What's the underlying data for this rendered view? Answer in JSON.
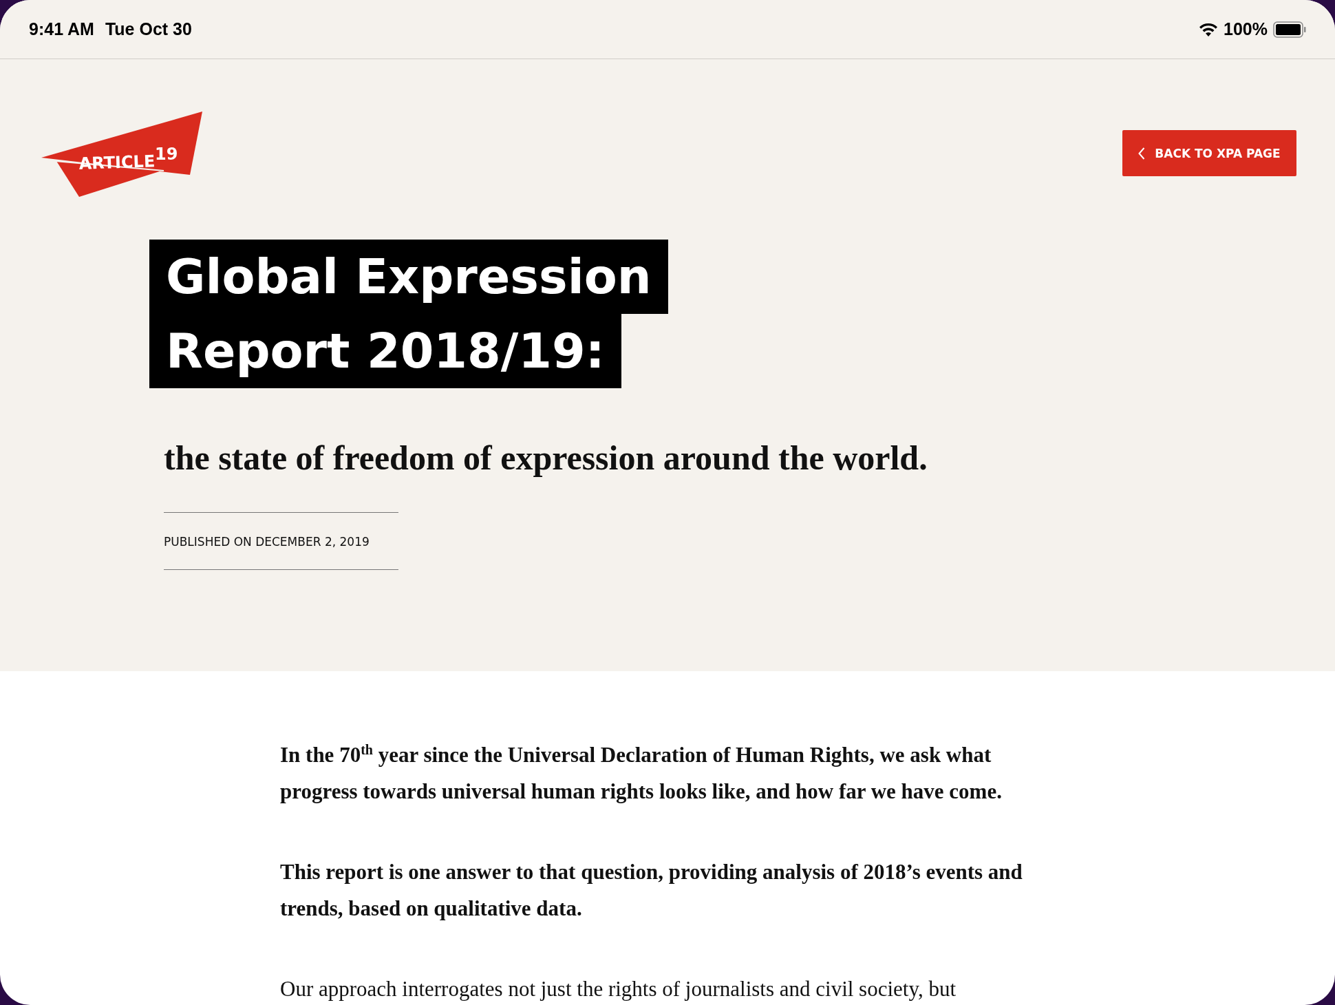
{
  "status_bar": {
    "time": "9:41 AM",
    "date": "Tue Oct 30",
    "battery": "100%"
  },
  "header": {
    "logo": {
      "word": "ARTICLE",
      "number": "19"
    },
    "back_button": "BACK TO XPA PAGE"
  },
  "title_lines": [
    "Global Expression",
    "Report 2018/19:"
  ],
  "subtitle": "the state of freedom of expression around the world.",
  "published": "PUBLISHED ON DECEMBER 2, 2019",
  "paragraphs": [
    {
      "kind": "lead",
      "text": "In the 70$^{th}$ year since the Universal Declaration of Human Rights, we ask what progress towards universal human rights looks like, and how far we have come."
    },
    {
      "kind": "lead",
      "text": "This report is one answer to that question, providing analysis of 2018’s events and trends, based on qualitative data."
    },
    {
      "kind": "body",
      "text": "Our approach interrogates not just the rights of journalists and civil society, but"
    }
  ]
}
